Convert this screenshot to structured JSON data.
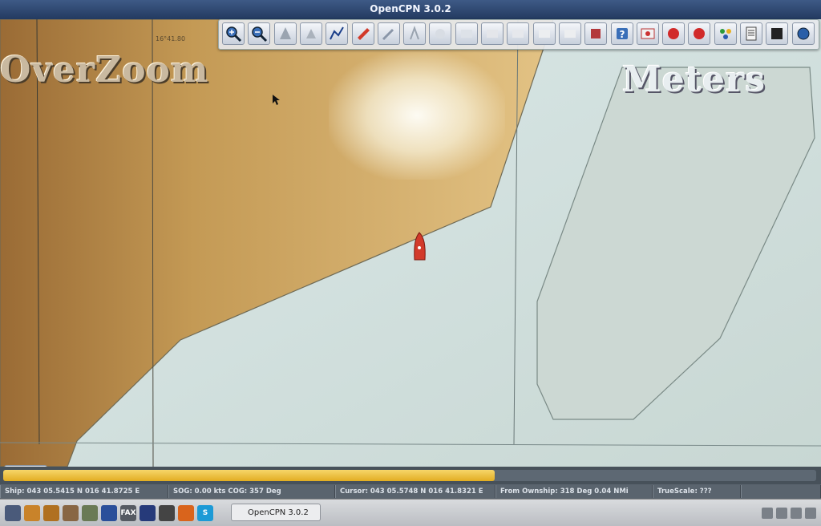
{
  "window": {
    "title": "OpenCPN 3.0.2"
  },
  "chart_overlay": {
    "overzoom_label": "OverZoom",
    "units_label": "Meters",
    "lon_gridline_label": "16°41.80"
  },
  "toolbar": {
    "buttons": [
      {
        "name": "zoom-in",
        "icon": "zoom-in-icon"
      },
      {
        "name": "zoom-out",
        "icon": "zoom-out-icon"
      },
      {
        "name": "scale-in",
        "icon": "scale-in-icon"
      },
      {
        "name": "scale-out",
        "icon": "scale-out-icon"
      },
      {
        "name": "route",
        "icon": "route-icon"
      },
      {
        "name": "auto-follow",
        "icon": "ship-icon"
      },
      {
        "name": "settings",
        "icon": "wrench-icon"
      },
      {
        "name": "text",
        "icon": "text-icon"
      },
      {
        "name": "current",
        "icon": "current-icon"
      },
      {
        "name": "tide",
        "icon": "tide-icon"
      },
      {
        "name": "route-manager",
        "icon": "route-manager-icon"
      },
      {
        "name": "track",
        "icon": "track-icon"
      },
      {
        "name": "color-scheme",
        "icon": "color-scheme-icon"
      },
      {
        "name": "ais",
        "icon": "ais-icon"
      },
      {
        "name": "print",
        "icon": "print-icon"
      },
      {
        "name": "help",
        "icon": "help-icon"
      },
      {
        "name": "grib",
        "icon": "grib-icon"
      },
      {
        "name": "alarm-1",
        "icon": "alarm-icon"
      },
      {
        "name": "alarm-2",
        "icon": "alarm-icon"
      },
      {
        "name": "dashboard",
        "icon": "dashboard-icon"
      },
      {
        "name": "logbook",
        "icon": "logbook-icon"
      },
      {
        "name": "radar",
        "icon": "radar-icon"
      },
      {
        "name": "globe",
        "icon": "globe-icon"
      }
    ]
  },
  "progress": {
    "value": 0.605
  },
  "status": {
    "ship": "Ship: 043 05.5415 N   016 41.8725 E",
    "sog": "SOG:  0.00 kts   COG:    357 Deg",
    "cursor": "Cursor: 043 05.5748 N 016 41.8321 E",
    "from_ownship": "From Ownship: 318 Deg    0.04 NMi",
    "truescale": "TrueScale:     ???"
  },
  "taskbar": {
    "apps": [
      {
        "icon": "ocean-icon",
        "color": "#4a5a7a"
      },
      {
        "icon": "sail-icon",
        "color": "#c9832a"
      },
      {
        "icon": "anchor-icon",
        "color": "#b07020"
      },
      {
        "icon": "tools-icon",
        "color": "#886644"
      },
      {
        "icon": "text-editor-icon",
        "color": "#6a7a55"
      },
      {
        "icon": "globe-icon",
        "color": "#2a4f9a"
      },
      {
        "icon": "fax-icon",
        "color": "#555a62",
        "text": "FAX"
      },
      {
        "icon": "weather-icon",
        "color": "#263a7a"
      },
      {
        "icon": "cloud-icon",
        "color": "#444"
      },
      {
        "icon": "firefox-icon",
        "color": "#d9641c"
      },
      {
        "icon": "skype-icon",
        "color": "#1c9ad6",
        "text": "S"
      }
    ],
    "task_button": "OpenCPN 3.0.2"
  },
  "colors": {
    "land": "#c39a55",
    "water_shallow": "#d6e6e6",
    "water_deep": "#c9d7d3",
    "ship": "#d23a2a",
    "accent": "#f0c348"
  }
}
